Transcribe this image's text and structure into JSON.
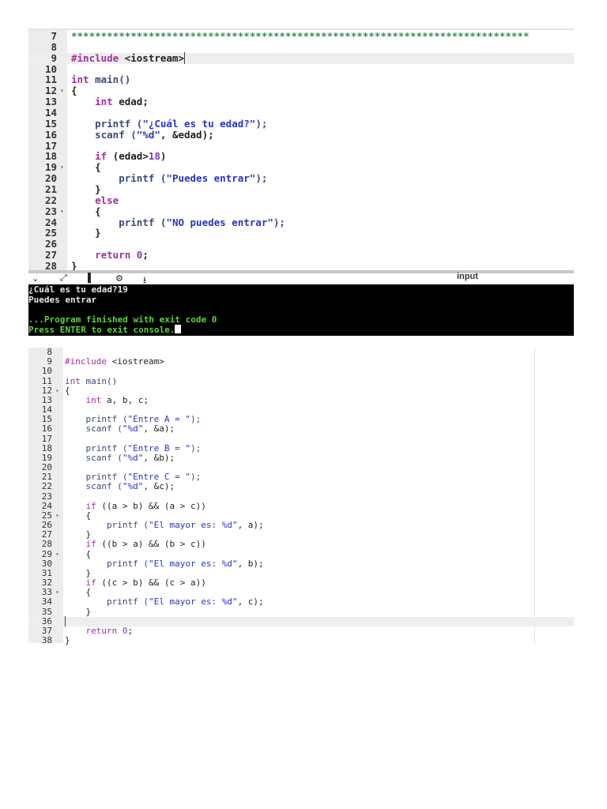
{
  "editor1": {
    "highlight_line": 9,
    "lines": [
      {
        "n": "7",
        "t": [
          [
            "cm",
            "*****************************************************************************"
          ]
        ]
      },
      {
        "n": "8",
        "t": []
      },
      {
        "n": "9",
        "t": [
          [
            "kw",
            "#include"
          ],
          [
            "",
            "<iostream>"
          ]
        ]
      },
      {
        "n": "10",
        "t": []
      },
      {
        "n": "11",
        "t": [
          [
            "kw",
            "int"
          ],
          [
            "fn",
            " main()"
          ]
        ]
      },
      {
        "n": "12",
        "f": true,
        "t": [
          [
            "",
            "{"
          ]
        ]
      },
      {
        "n": "13",
        "t": [
          [
            "",
            "    "
          ],
          [
            "kw",
            "int"
          ],
          [
            "",
            " edad;"
          ]
        ]
      },
      {
        "n": "14",
        "t": []
      },
      {
        "n": "15",
        "t": [
          [
            "fn",
            "    printf ("
          ],
          [
            "str",
            "\"¿Cuál es tu edad?\""
          ],
          [
            "fn",
            ");"
          ]
        ]
      },
      {
        "n": "16",
        "t": [
          [
            "fn",
            "    scanf ("
          ],
          [
            "str",
            "\"%d\""
          ],
          [
            "",
            ", &edad);"
          ]
        ]
      },
      {
        "n": "17",
        "t": []
      },
      {
        "n": "18",
        "t": [
          [
            "",
            "    "
          ],
          [
            "kw",
            "if"
          ],
          [
            "",
            " (edad>"
          ],
          [
            "num",
            "18"
          ],
          [
            "",
            ")"
          ]
        ]
      },
      {
        "n": "19",
        "f": true,
        "t": [
          [
            "",
            "    {"
          ]
        ]
      },
      {
        "n": "20",
        "t": [
          [
            "fn",
            "        printf ("
          ],
          [
            "str",
            "\"Puedes entrar\""
          ],
          [
            "fn",
            ");"
          ]
        ]
      },
      {
        "n": "21",
        "t": [
          [
            "",
            "    }"
          ]
        ]
      },
      {
        "n": "22",
        "t": [
          [
            "",
            "    "
          ],
          [
            "kw",
            "else"
          ]
        ]
      },
      {
        "n": "23",
        "f": true,
        "t": [
          [
            "",
            "    {"
          ]
        ]
      },
      {
        "n": "24",
        "t": [
          [
            "fn",
            "        printf ("
          ],
          [
            "str",
            "\"NO puedes entrar\""
          ],
          [
            "fn",
            ");"
          ]
        ]
      },
      {
        "n": "25",
        "t": [
          [
            "",
            "    }"
          ]
        ]
      },
      {
        "n": "26",
        "t": []
      },
      {
        "n": "27",
        "t": [
          [
            "",
            "    "
          ],
          [
            "kw",
            "return"
          ],
          [
            "",
            " "
          ],
          [
            "num",
            "0"
          ],
          [
            "",
            ";"
          ]
        ]
      },
      {
        "n": "28",
        "t": [
          [
            "",
            "}"
          ]
        ]
      }
    ]
  },
  "toolbar": {
    "icons": [
      "chevron-down-icon",
      "expand-icon",
      "copy-icon",
      "gear-icon",
      "stop-icon"
    ],
    "input_label": "input"
  },
  "console": {
    "lines": [
      {
        "c": "white",
        "t": "¿Cuál es tu edad?19"
      },
      {
        "c": "white",
        "t": "Puedes entrar"
      },
      {
        "c": "white",
        "t": ""
      },
      {
        "c": "green",
        "t": "...Program finished with exit code 0"
      },
      {
        "c": "green",
        "t": "Press ENTER to exit console.",
        "cursor": true
      }
    ]
  },
  "editor2": {
    "highlight_line": 36,
    "lines": [
      {
        "n": "8",
        "t": []
      },
      {
        "n": "9",
        "t": [
          [
            "kw",
            "#include"
          ],
          [
            "",
            " <iostream>"
          ]
        ]
      },
      {
        "n": "10",
        "t": []
      },
      {
        "n": "11",
        "t": [
          [
            "kw",
            "int"
          ],
          [
            "fn",
            " main()"
          ]
        ]
      },
      {
        "n": "12",
        "f": true,
        "t": [
          [
            "",
            "{"
          ]
        ]
      },
      {
        "n": "13",
        "t": [
          [
            "",
            "    "
          ],
          [
            "kw",
            "int"
          ],
          [
            "",
            " a, b, c;"
          ]
        ]
      },
      {
        "n": "14",
        "t": []
      },
      {
        "n": "15",
        "t": [
          [
            "fn",
            "    printf ("
          ],
          [
            "str",
            "\"Entre A = \""
          ],
          [
            "fn",
            ");"
          ]
        ]
      },
      {
        "n": "16",
        "t": [
          [
            "fn",
            "    scanf ("
          ],
          [
            "str",
            "\"%d\""
          ],
          [
            "",
            ", &a);"
          ]
        ]
      },
      {
        "n": "17",
        "t": []
      },
      {
        "n": "18",
        "t": [
          [
            "fn",
            "    printf ("
          ],
          [
            "str",
            "\"Entre B = \""
          ],
          [
            "fn",
            ");"
          ]
        ]
      },
      {
        "n": "19",
        "t": [
          [
            "fn",
            "    scanf ("
          ],
          [
            "str",
            "\"%d\""
          ],
          [
            "",
            ", &b);"
          ]
        ]
      },
      {
        "n": "20",
        "t": []
      },
      {
        "n": "21",
        "t": [
          [
            "fn",
            "    printf ("
          ],
          [
            "str",
            "\"Entre C = \""
          ],
          [
            "fn",
            ");"
          ]
        ]
      },
      {
        "n": "22",
        "t": [
          [
            "fn",
            "    scanf ("
          ],
          [
            "str",
            "\"%d\""
          ],
          [
            "",
            ", &c);"
          ]
        ]
      },
      {
        "n": "23",
        "t": []
      },
      {
        "n": "24",
        "t": [
          [
            "",
            "    "
          ],
          [
            "kw",
            "if"
          ],
          [
            "",
            " ((a > b) && (a > c))"
          ]
        ]
      },
      {
        "n": "25",
        "f": true,
        "t": [
          [
            "",
            "    {"
          ]
        ]
      },
      {
        "n": "26",
        "t": [
          [
            "fn",
            "        printf ("
          ],
          [
            "str",
            "\"El mayor es: %d\""
          ],
          [
            "",
            ", a);"
          ]
        ]
      },
      {
        "n": "27",
        "t": [
          [
            "",
            "    }"
          ]
        ]
      },
      {
        "n": "28",
        "t": [
          [
            "",
            "    "
          ],
          [
            "kw",
            "if"
          ],
          [
            "",
            " ((b > a) && (b > c))"
          ]
        ]
      },
      {
        "n": "29",
        "f": true,
        "t": [
          [
            "",
            "    {"
          ]
        ]
      },
      {
        "n": "30",
        "t": [
          [
            "fn",
            "        printf ("
          ],
          [
            "str",
            "\"El mayor es: %d\""
          ],
          [
            "",
            ", b);"
          ]
        ]
      },
      {
        "n": "31",
        "t": [
          [
            "",
            "    }"
          ]
        ]
      },
      {
        "n": "32",
        "t": [
          [
            "",
            "    "
          ],
          [
            "kw",
            "if"
          ],
          [
            "",
            " ((c > b) && (c > a))"
          ]
        ]
      },
      {
        "n": "33",
        "f": true,
        "t": [
          [
            "",
            "    {"
          ]
        ]
      },
      {
        "n": "34",
        "t": [
          [
            "fn",
            "        printf ("
          ],
          [
            "str",
            "\"El mayor es: %d\""
          ],
          [
            "",
            ", c);"
          ]
        ]
      },
      {
        "n": "35",
        "t": [
          [
            "",
            "    }"
          ]
        ]
      },
      {
        "n": "36",
        "t": []
      },
      {
        "n": "37",
        "t": [
          [
            "",
            "    "
          ],
          [
            "kw",
            "return"
          ],
          [
            "",
            " "
          ],
          [
            "num",
            "0"
          ],
          [
            "",
            ";"
          ]
        ]
      },
      {
        "n": "38",
        "t": [
          [
            "",
            "}"
          ]
        ]
      }
    ]
  }
}
